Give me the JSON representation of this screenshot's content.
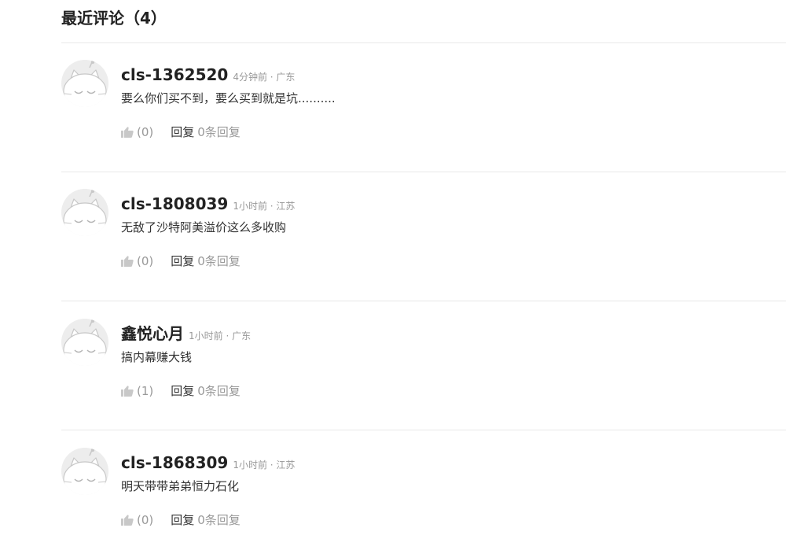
{
  "section": {
    "title": "最近评论（4）"
  },
  "comments": [
    {
      "username": "cls-1362520",
      "meta": "4分钟前 · 广东",
      "text": "要么你们买不到，要么买到就是坑..........",
      "likes": "(0)",
      "reply_label": "回复",
      "reply_count": "0条回复"
    },
    {
      "username": "cls-1808039",
      "meta": "1小时前 · 江苏",
      "text": "无敌了沙特阿美溢价这么多收购",
      "likes": "(0)",
      "reply_label": "回复",
      "reply_count": "0条回复"
    },
    {
      "username": "鑫悦心月",
      "meta": "1小时前 · 广东",
      "text": "搞内幕赚大钱",
      "likes": "(1)",
      "reply_label": "回复",
      "reply_count": "0条回复"
    },
    {
      "username": "cls-1868309",
      "meta": "1小时前 · 江苏",
      "text": "明天带带弟弟恒力石化",
      "likes": "(0)",
      "reply_label": "回复",
      "reply_count": "0条回复"
    }
  ],
  "icons": {
    "avatar": "default-cat-avatar-icon",
    "like": "thumbs-up-icon"
  },
  "colors": {
    "text_primary": "#222222",
    "text_secondary": "#999999",
    "divider": "#e8e8e8",
    "avatar_bg": "#ededed"
  }
}
